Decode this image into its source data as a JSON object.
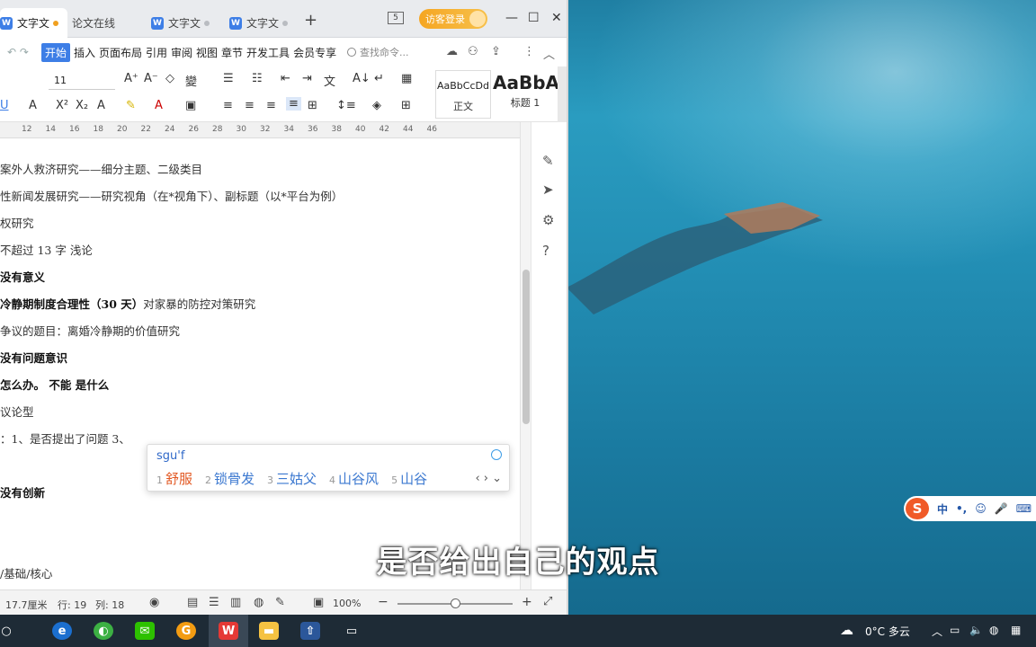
{
  "window": {
    "tabs": [
      {
        "label": "文字文"
      },
      {
        "label": "论文在线"
      },
      {
        "label": "文字文"
      },
      {
        "label": "文字文"
      }
    ],
    "page_badge": "5",
    "visitor_login": "访客登录"
  },
  "menu": {
    "items": [
      "开始",
      "插入",
      "页面布局",
      "引用",
      "审阅",
      "视图",
      "章节",
      "开发工具",
      "会员专享"
    ],
    "search_placeholder": "查找命令..."
  },
  "ribbon": {
    "font_size": "11",
    "style_normal_sample": "AaBbCcDd",
    "style_normal_label": "正文",
    "style_heading_sample": "AaBbA",
    "style_heading_label": "标题 1"
  },
  "ruler": {
    "ticks": [
      "14",
      "16",
      "18",
      "20",
      "22",
      "24",
      "26",
      "28",
      "30",
      "32",
      "34",
      "36",
      "38",
      "40",
      "42",
      "44",
      "46"
    ],
    "lead_ticks": [
      "12"
    ]
  },
  "document": {
    "lines": [
      {
        "text": "案外人救济研究——细分主题、二级类目",
        "bold": false
      },
      {
        "text": "性新闻发展研究——研究视角（在*视角下）、副标题（以*平台为例）",
        "bold": false
      },
      {
        "text": "权研究",
        "bold": false
      },
      {
        "text": "不超过 13 字  浅论",
        "bold": false
      },
      {
        "text": "没有意义",
        "bold": true
      },
      {
        "text": "冷静期制度合理性（30 天）",
        "bold": true,
        "rest": "对家暴的防控对策研究"
      },
      {
        "text": "争议的题目：离婚冷静期的价值研究",
        "bold": false
      },
      {
        "text": "没有问题意识",
        "bold": true
      },
      {
        "text": "怎么办。 不能 是什么",
        "bold": true
      },
      {
        "text": "议论型",
        "bold": false
      },
      {
        "text": "：1、是否提出了问题 3、",
        "bold": false
      },
      {
        "text": "",
        "bold": false
      },
      {
        "text": "没有创新",
        "bold": true
      },
      {
        "text": "",
        "bold": false
      },
      {
        "text": "",
        "bold": false
      },
      {
        "text": "/基础/核心",
        "bold": false
      }
    ]
  },
  "ime": {
    "composition": "sgu'f",
    "candidates": [
      {
        "num": "1",
        "text": "舒服"
      },
      {
        "num": "2",
        "text": "锁骨发"
      },
      {
        "num": "3",
        "text": "三姑父"
      },
      {
        "num": "4",
        "text": "山谷风"
      },
      {
        "num": "5",
        "text": "山谷"
      }
    ],
    "toolbar_mode": "中"
  },
  "statusbar": {
    "position": "17.7厘米",
    "row": "行: 19",
    "col": "列: 18",
    "zoom": "100%",
    "zoom_level": 0.5
  },
  "subtitle": "是否给出自己的观点",
  "taskbar": {
    "weather": "0°C  多云"
  },
  "colors": {
    "accent": "#3d7ee6",
    "visitor": "#f5a623",
    "ime_selected": "#e25822",
    "taskbar": "#1e2b36"
  }
}
